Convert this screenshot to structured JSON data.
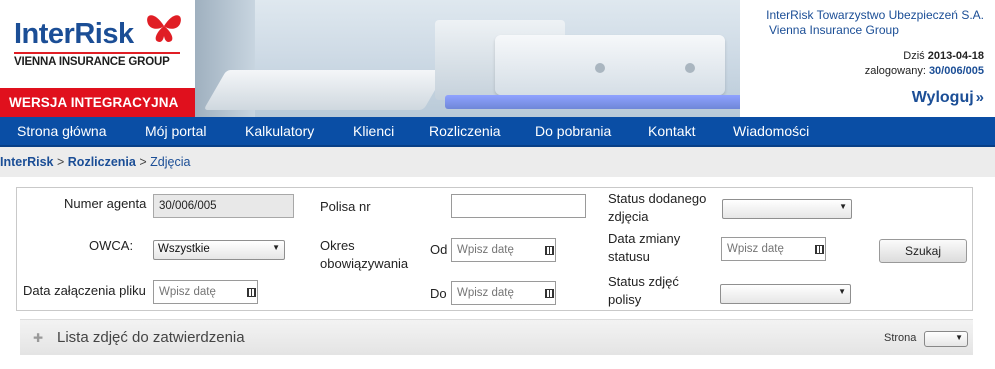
{
  "header": {
    "brand": "InterRisk",
    "tagline": "VIENNA INSURANCE GROUP",
    "version_banner": "WERSJA INTEGRACYJNA",
    "company_name": "InterRisk Towarzystwo Ubezpieczeń S.A.",
    "company_group": "Vienna Insurance Group",
    "date_label": "Dziś",
    "date_value": "2013-04-18",
    "login_label": "zalogowany:",
    "login_value": "30/006/005",
    "logout_label": "Wyloguj",
    "logout_icon": "»"
  },
  "nav": {
    "items": [
      {
        "label": "Strona główna"
      },
      {
        "label": "Mój portal"
      },
      {
        "label": "Kalkulatory"
      },
      {
        "label": "Klienci"
      },
      {
        "label": "Rozliczenia"
      },
      {
        "label": "Do pobrania"
      },
      {
        "label": "Kontakt"
      },
      {
        "label": "Wiadomości"
      }
    ]
  },
  "breadcrumb": {
    "items": [
      "InterRisk",
      "Rozliczenia",
      "Zdjęcia"
    ],
    "separator": ">"
  },
  "form": {
    "agent_number_label": "Numer agenta",
    "agent_number_value": "30/006/005",
    "policy_number_label": "Polisa nr",
    "policy_number_value": "",
    "photo_status_label_1": "Status dodanego",
    "photo_status_label_2": "zdjęcia",
    "photo_status_value": "",
    "owca_label": "OWCA:",
    "owca_value": "Wszystkie",
    "period_label_1": "Okres",
    "period_label_2": "obowiązywania",
    "from_label": "Od",
    "from_placeholder": "Wpisz datę",
    "status_change_label_1": "Data zmiany",
    "status_change_label_2": "statusu",
    "status_change_placeholder": "Wpisz datę",
    "search_button": "Szukaj",
    "attach_date_label": "Data załączenia pliku",
    "attach_date_placeholder": "Wpisz datę",
    "to_label": "Do",
    "to_placeholder": "Wpisz datę",
    "policy_photo_status_label_1": "Status zdjęć",
    "policy_photo_status_label_2": "polisy",
    "policy_photo_status_value": ""
  },
  "list": {
    "title": "Lista zdjęć do zatwierdzenia",
    "page_label": "Strona",
    "page_value": ""
  },
  "colors": {
    "brand_blue": "#1b4e96",
    "nav_blue": "#0a4ea5",
    "banner_red": "#e0101d"
  },
  "icons": {
    "calendar": "calendar-icon",
    "dropdown": "chevron-down-icon",
    "list_toggle": "expand-icon",
    "butterfly": "butterfly-logo-icon",
    "logout": "double-chevron-right-icon"
  }
}
